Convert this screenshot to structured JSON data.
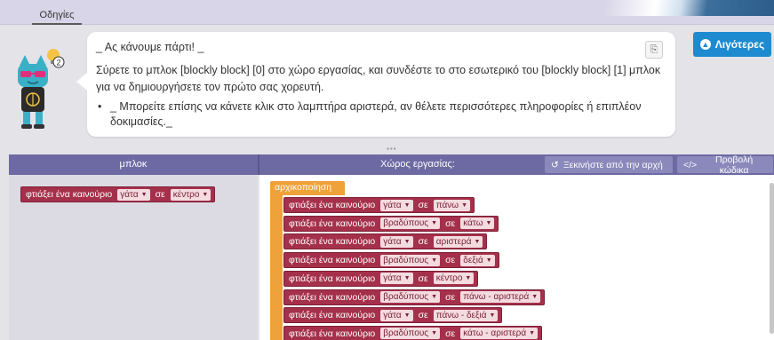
{
  "topbar": {
    "tab_label": "Οδηγίες"
  },
  "instructions": {
    "title": "_ Ας κάνουμε πάρτι! _",
    "body": "Σύρετε το μπλοκ [blockly block] [0] στο χώρο εργασίας, και συνδέστε το στο εσωτερικό του [blockly block] [1] μπλοκ για να δημιουργήσετε τον πρώτο σας χορευτή.",
    "tip": "_ Μπορείτε επίσης να κάνετε κλικ στο λαμπτήρα αριστερά, αν θέλετε περισσότερες πληροφορίες ή επιπλέον δοκιμασίες._",
    "less_button": "Λιγότερες",
    "avatar_badge": "2",
    "resize_handle": "▪▪▪"
  },
  "header": {
    "toolbox_label": "μπλοκ",
    "workspace_label": "Χώρος εργασίας:",
    "restart_label": "Ξεκινήστε από την αρχή",
    "show_code_label": "Προβολή κώδικα"
  },
  "toolbox_block": {
    "text": "φτιάξει ένα καινούριο",
    "creature": "γάτα",
    "in_label": "σε",
    "position": "κέντρο"
  },
  "workspace": {
    "init_label": "αρχικοποίηση",
    "blocks": [
      {
        "text": "φτιάξει ένα καινούριο",
        "creature": "γάτα",
        "in_label": "σε",
        "position": "πάνω"
      },
      {
        "text": "φτιάξει ένα καινούριο",
        "creature": "βραδύπους",
        "in_label": "σε",
        "position": "κάτω"
      },
      {
        "text": "φτιάξει ένα καινούριο",
        "creature": "γάτα",
        "in_label": "σε",
        "position": "αριστερά"
      },
      {
        "text": "φτιάξει ένα καινούριο",
        "creature": "βραδύπους",
        "in_label": "σε",
        "position": "δεξιά"
      },
      {
        "text": "φτιάξει ένα καινούριο",
        "creature": "γάτα",
        "in_label": "σε",
        "position": "κέντρο"
      },
      {
        "text": "φτιάξει ένα καινούριο",
        "creature": "βραδύπους",
        "in_label": "σε",
        "position": "πάνω - αριστερά"
      },
      {
        "text": "φτιάξει ένα καινούριο",
        "creature": "γάτα",
        "in_label": "σε",
        "position": "πάνω - δεξιά"
      },
      {
        "text": "φτιάξει ένα καινούριο",
        "creature": "βραδύπους",
        "in_label": "σε",
        "position": "κάτω - αριστερά"
      }
    ]
  },
  "colors": {
    "block_red": "#a5304b",
    "init_orange": "#f0a23a",
    "header_purple": "#6d6aa3",
    "accent_blue": "#1e8bd1"
  }
}
